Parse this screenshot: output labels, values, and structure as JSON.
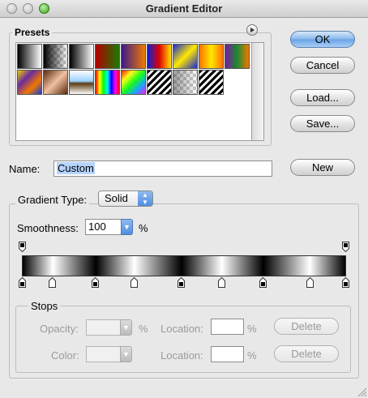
{
  "window": {
    "title": "Gradient Editor"
  },
  "presets": {
    "label": "Presets",
    "swatches": [
      {
        "name": "foreground-to-background",
        "bg": "linear-gradient(90deg,#000,#fff)"
      },
      {
        "name": "foreground-to-transparent",
        "bg": "checker-black"
      },
      {
        "name": "black-white",
        "bg": "linear-gradient(90deg,#000,#fff)"
      },
      {
        "name": "red-green",
        "bg": "linear-gradient(90deg,#b40000,#1b7a00)"
      },
      {
        "name": "violet-orange",
        "bg": "linear-gradient(90deg,#3a1a8a,#f07800)"
      },
      {
        "name": "blue-red-yellow",
        "bg": "linear-gradient(90deg,#1020d0,#e00000,#ffe000)"
      },
      {
        "name": "blue-yellow-blue",
        "bg": "linear-gradient(135deg,#1a2ad0,#ffe800,#1a2ad0)"
      },
      {
        "name": "orange-yellow-orange",
        "bg": "linear-gradient(90deg,#ff7000,#ffe800,#ff7000)"
      },
      {
        "name": "violet-green-orange",
        "bg": "linear-gradient(90deg,#7a1aa0,#1a8a30,#f07800)"
      },
      {
        "name": "yellow-violet-orange-blue",
        "bg": "linear-gradient(135deg,#f0d000,#6a2aa0,#f07800,#1a3ad0)"
      },
      {
        "name": "copper",
        "bg": "linear-gradient(135deg,#5a2a10,#f0c0a0,#5a2a10)"
      },
      {
        "name": "chrome",
        "bg": "linear-gradient(180deg,#fff 0%,#9ad0ff 45%,#5a3a10 55%,#fff 100%)"
      },
      {
        "name": "spectrum",
        "bg": "linear-gradient(90deg,#f00,#ff0,#0f0,#0ff,#00f,#f0f,#f00)"
      },
      {
        "name": "transparent-rainbow",
        "bg": "checker-rainbow"
      },
      {
        "name": "transparent-stripes",
        "bg": "stripes-black"
      },
      {
        "name": "neutral-density",
        "bg": "checker-gray"
      },
      {
        "name": "black-white-stripes",
        "bg": "stripes-bw"
      }
    ]
  },
  "buttons": {
    "ok": "OK",
    "cancel": "Cancel",
    "load": "Load...",
    "save": "Save...",
    "new": "New"
  },
  "name_field": {
    "label": "Name:",
    "value": "Custom"
  },
  "gradient_type": {
    "label": "Gradient Type:",
    "value": "Solid"
  },
  "smoothness": {
    "label": "Smoothness:",
    "value": "100",
    "unit": "%"
  },
  "gradient": {
    "opacity_stops": [
      0,
      1
    ],
    "color_stops": [
      0,
      0.0937,
      0.227,
      0.346,
      0.493,
      0.617,
      0.746,
      0.89,
      1
    ],
    "stop_colors": [
      "#000000",
      "#ffffff",
      "#000000",
      "#ffffff",
      "#000000",
      "#ffffff",
      "#000000",
      "#ffffff",
      "#000000"
    ]
  },
  "stops": {
    "label": "Stops",
    "opacity_label": "Opacity:",
    "opacity_unit": "%",
    "color_label": "Color:",
    "location_label": "Location:",
    "location_unit": "%",
    "delete_label": "Delete"
  },
  "colors": {
    "default_button": "#6aa3e6",
    "selection": "#b5d4fd"
  }
}
